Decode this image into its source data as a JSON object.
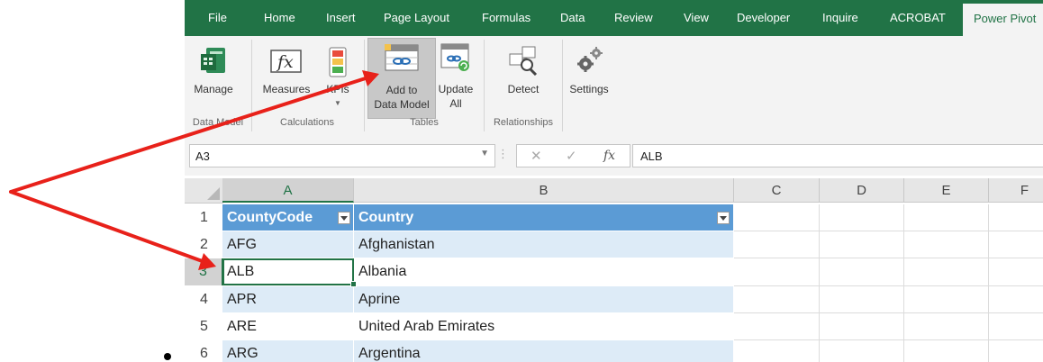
{
  "menu": {
    "tabs": [
      "File",
      "Home",
      "Insert",
      "Page Layout",
      "Formulas",
      "Data",
      "Review",
      "View",
      "Developer",
      "Inquire",
      "ACROBAT",
      "Power Pivot"
    ],
    "active_tab": "Power Pivot"
  },
  "ribbon": {
    "manage": "Manage",
    "measures": "Measures",
    "kpis": "KPIs",
    "add_line1": "Add to",
    "add_line2": "Data Model",
    "update_line1": "Update",
    "update_line2": "All",
    "detect": "Detect",
    "settings": "Settings",
    "groups": {
      "data_model": "Data Model",
      "calculations": "Calculations",
      "tables": "Tables",
      "relationships": "Relationships"
    }
  },
  "formula_bar": {
    "name_box": "A3",
    "formula": "ALB",
    "fx": "fx",
    "cancel": "✕",
    "enter": "✓"
  },
  "sheet": {
    "columns": [
      "A",
      "B",
      "C",
      "D",
      "E",
      "F"
    ],
    "rows": [
      {
        "num": "1",
        "a": "CountyCode",
        "b": "Country"
      },
      {
        "num": "2",
        "a": "AFG",
        "b": "Afghanistan"
      },
      {
        "num": "3",
        "a": "ALB",
        "b": "Albania"
      },
      {
        "num": "4",
        "a": "APR",
        "b": "Aprine"
      },
      {
        "num": "5",
        "a": "ARE",
        "b": "United Arab Emirates"
      },
      {
        "num": "6",
        "a": "ARG",
        "b": "Argentina"
      }
    ]
  },
  "colors": {
    "excel_green": "#217346",
    "table_header": "#5b9bd5",
    "table_band": "#ddebf7",
    "annotation_arrow": "#e8211a"
  }
}
